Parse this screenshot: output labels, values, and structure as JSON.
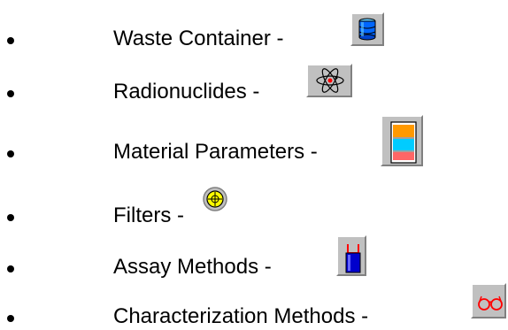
{
  "items": [
    {
      "label": "Waste Container",
      "separator": " -",
      "icon": "waste-container-icon"
    },
    {
      "label": "Radionuclides",
      "separator": " -",
      "icon": "radionuclides-icon"
    },
    {
      "label": "Material Parameters",
      "separator": " -",
      "icon": "material-parameters-icon"
    },
    {
      "label": "Filters",
      "separator": " -",
      "icon": "filters-icon"
    },
    {
      "label": "Assay Methods",
      "separator": " -",
      "icon": "assay-methods-icon"
    },
    {
      "label": "Characterization Methods",
      "separator": " -",
      "icon": "characterization-methods-icon"
    }
  ],
  "colors": {
    "button_face": "#c0c0c0",
    "container_blue": "#0066ff",
    "filter_yellow": "#ffff00",
    "glasses_red": "#ff0000",
    "assay_blue": "#0000cc",
    "material_orange": "#ff9900",
    "material_cyan": "#00ccff"
  }
}
